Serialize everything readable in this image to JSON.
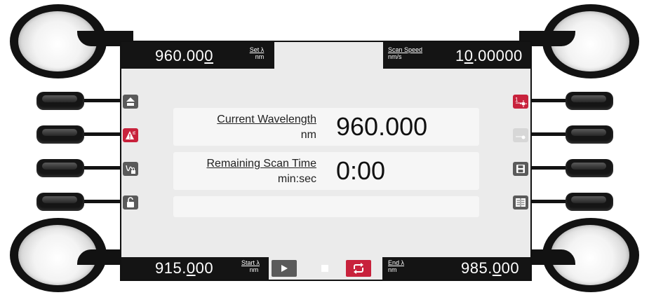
{
  "top": {
    "set_wavelength": {
      "value_pre": "960.00",
      "value_ul": "0",
      "label": "Set λ",
      "unit": "nm"
    },
    "scan_speed": {
      "value_pre": "1",
      "value_ul": "0",
      "value_post": ".00000",
      "label": "Scan Speed",
      "unit": "nm/s"
    }
  },
  "bottom": {
    "start_wavelength": {
      "value_pre": "915.",
      "value_ul": "0",
      "value_post": "00",
      "label": "Start λ",
      "unit": "nm"
    },
    "end_wavelength": {
      "value_pre": "985.",
      "value_ul": "0",
      "value_post": "00",
      "label": "End λ",
      "unit": "nm"
    }
  },
  "readouts": {
    "current_wavelength": {
      "label": "Current Wavelength",
      "unit": "nm",
      "value": "960.000"
    },
    "remaining_scan_time": {
      "label": "Remaining Scan Time",
      "unit": "min:sec",
      "value": "0:00"
    }
  },
  "icons": {
    "left": [
      "home-icon",
      "warning-icon",
      "scan-lock-icon",
      "unlock-icon"
    ],
    "right": [
      "laser-1-icon",
      "laser-2-icon",
      "save-icon",
      "log-icon"
    ],
    "transport": [
      "play-icon",
      "stop-icon",
      "repeat-icon"
    ]
  },
  "colors": {
    "accent": "#c8223c",
    "bar": "#141414",
    "screen": "#ebebeb"
  }
}
